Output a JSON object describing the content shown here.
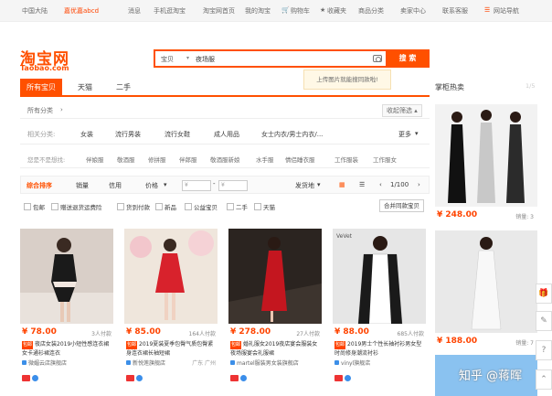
{
  "topbar": {
    "region": "中国大陆",
    "greeting": "嘉优嘉abcd",
    "messages": "消息",
    "mobile": "手机逛淘宝",
    "home": "淘宝网首页",
    "my_taobao": "我的淘宝",
    "cart": "购物车",
    "favorites": "收藏夹",
    "categories": "商品分类",
    "seller_center": "卖家中心",
    "contact": "联系客服",
    "sitemap": "网站导航"
  },
  "header": {
    "logo_cn": "淘宝网",
    "logo_en": "Taobao.com"
  },
  "search": {
    "category": "宝贝",
    "query": "夜场服",
    "button": "搜 索",
    "tooltip": "上传图片就能搜同款啦!"
  },
  "tabs": [
    {
      "label": "所有宝贝"
    },
    {
      "label": "天猫"
    },
    {
      "label": "二手"
    }
  ],
  "category_row": {
    "label": "所有分类",
    "collapse": "收起筛选"
  },
  "related": {
    "label": "相关分类:",
    "items": [
      "女装",
      "流行男装",
      "流行女鞋",
      "成人用品",
      "女士内衣/男士内衣/..."
    ],
    "more": "更多"
  },
  "wants": {
    "label": "您是不是想找:",
    "items": [
      "伴娘服",
      "敬酒服",
      "修拼服",
      "伴郎服",
      "敬酒服新娘",
      "水手服",
      "情侣睡衣服",
      "工作服装",
      "工作服女"
    ]
  },
  "sort": {
    "default": "综合排序",
    "sales": "销量",
    "credit": "信用",
    "price": "价格",
    "price_from": "¥",
    "price_to": "¥",
    "ship_from": "发货地",
    "page": "1/100"
  },
  "filters": {
    "items": [
      "包邮",
      "赠送退货运费险",
      "货到付款",
      "新品",
      "公益宝贝",
      "二手",
      "天猫"
    ],
    "merge": "合并同款宝贝"
  },
  "products": [
    {
      "price": "¥ 78.00",
      "sales": "3人付款",
      "badge": "包邮",
      "title": "夜店女装2019小短性感连衣裙女卡通衫裙连衣",
      "shop": "微媚云店旗舰店",
      "loc": ""
    },
    {
      "price": "¥ 85.00",
      "sales": "164人付款",
      "badge": "包邮",
      "title": "2019夏装夏季包臀气质包臀紧身连衣裙长袖短裙",
      "shop": "新悦莲旗舰店",
      "loc": "广东 广州"
    },
    {
      "price": "¥ 278.00",
      "sales": "27人付款",
      "badge": "包邮",
      "title": "婚礼服女2019夜店宴会服装女夜场服宴会礼服裙",
      "shop": "martel服装男女装旗舰店",
      "loc": ""
    },
    {
      "price": "¥ 88.00",
      "sales": "685人付款",
      "badge": "包邮",
      "title": "2019男士个性长袖衬衫男女型时尚修身潮流衬衫",
      "shop": "vinyl旗舰店",
      "loc": ""
    }
  ],
  "right_column": {
    "title": "掌柜热卖",
    "more": "1/5",
    "items": [
      {
        "price": "¥ 248.00",
        "sales": "销量: 3"
      },
      {
        "price": "¥ 188.00",
        "sales": "销量: 7"
      }
    ]
  },
  "watermark": "知乎 @蒋晖"
}
